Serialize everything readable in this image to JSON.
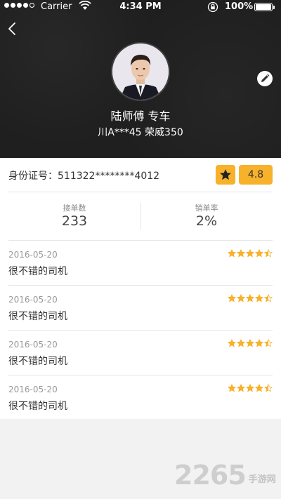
{
  "status_bar": {
    "carrier": "Carrier",
    "time": "4:34 PM",
    "battery": "100%"
  },
  "driver": {
    "name": "陆师傅 专车",
    "car": "川A***45 荣威350"
  },
  "profile": {
    "id_label": "身份证号：",
    "id_number": "511322********4012",
    "score": "4.8"
  },
  "stats": {
    "orders_label": "接单数",
    "orders_value": "233",
    "cancel_label": "销单率",
    "cancel_value": "2%"
  },
  "reviews": [
    {
      "date": "2016-05-20",
      "text": "很不错的司机",
      "rating": 4.5
    },
    {
      "date": "2016-05-20",
      "text": "很不错的司机",
      "rating": 4.5
    },
    {
      "date": "2016-05-20",
      "text": "很不错的司机",
      "rating": 4.5
    },
    {
      "date": "2016-05-20",
      "text": "很不错的司机",
      "rating": 4.5
    }
  ],
  "watermark": {
    "number": "2265",
    "suffix": "手游网"
  },
  "colors": {
    "accent": "#f7b12b",
    "header_bg": "#1f1f1f"
  },
  "icons": [
    "back-arrow-icon",
    "edit-pencil-icon",
    "star-icon",
    "wifi-icon",
    "lock-rotation-icon",
    "battery-icon"
  ]
}
